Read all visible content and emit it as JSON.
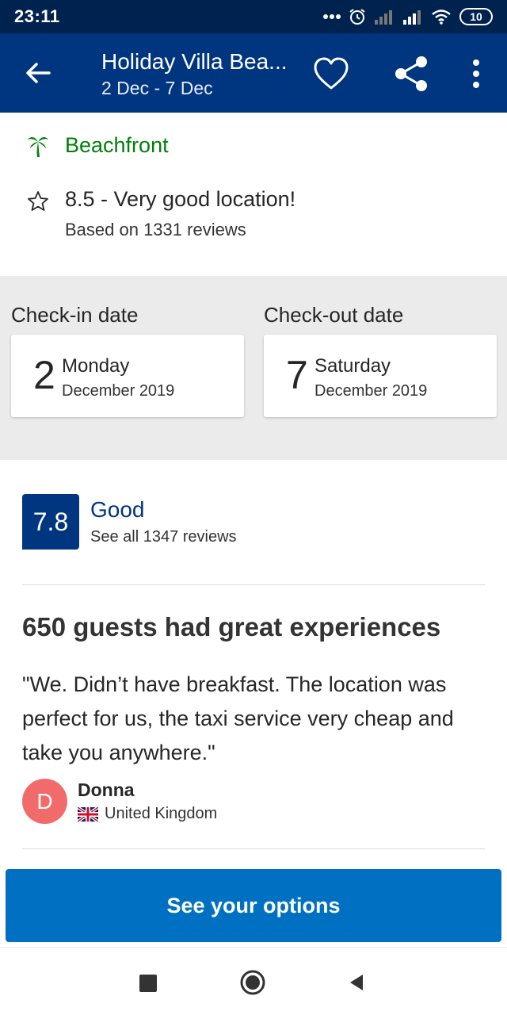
{
  "status_bar": {
    "time": "23:11",
    "battery": "10",
    "icons": [
      "more-dots-icon",
      "alarm-icon",
      "signal-icon",
      "signal-icon",
      "wifi-icon",
      "battery-icon"
    ]
  },
  "app_bar": {
    "title": "Holiday Villa Bea...",
    "subtitle": "2 Dec - 7 Dec",
    "icons": [
      "back-arrow-icon",
      "heart-icon",
      "share-icon",
      "more-vert-icon"
    ]
  },
  "highlights": {
    "beachfront": {
      "icon": "palm-tree-icon",
      "label": "Beachfront",
      "color": "#008009"
    },
    "location": {
      "icon": "star-outline-icon",
      "score_text": "8.5 - Very good location!",
      "reviews_text": "Based on 1331 reviews"
    }
  },
  "dates": {
    "checkin": {
      "label": "Check-in date",
      "day": "2",
      "weekday": "Monday",
      "month_year": "December 2019"
    },
    "checkout": {
      "label": "Check-out date",
      "day": "7",
      "weekday": "Saturday",
      "month_year": "December 2019"
    }
  },
  "rating": {
    "score": "7.8",
    "word": "Good",
    "reviews_link": "See all 1347 reviews",
    "badge_color": "#003580"
  },
  "review": {
    "heading": "650 guests had great experiences",
    "quote": "\"We. Didn’t have breakfast. The location was perfect for us, the taxi service very cheap and take you anywhere.\"",
    "author_initial": "D",
    "author_name": "Donna",
    "author_country": "United Kingdom",
    "flag_icon": "uk-flag-icon"
  },
  "cta": {
    "label": "See your options",
    "color": "#0071c2"
  },
  "nav_bar": {
    "icons": [
      "recent-apps-icon",
      "home-icon",
      "back-icon"
    ]
  }
}
